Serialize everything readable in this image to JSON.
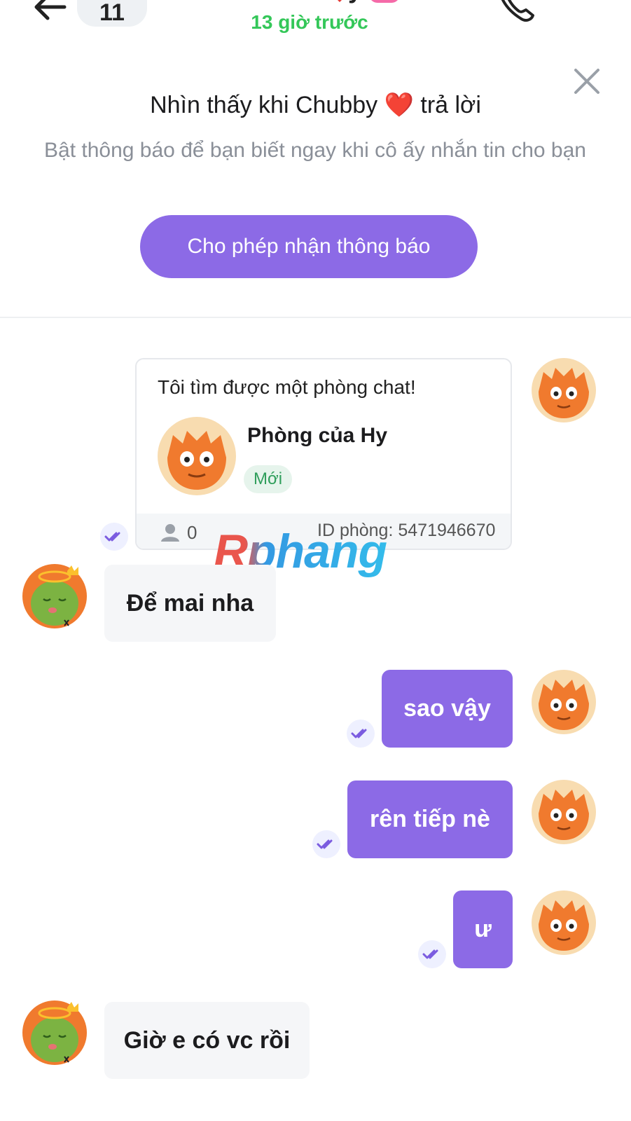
{
  "header": {
    "unread_count": "11",
    "contact_name": "Chubby",
    "status": "13 giờ trước"
  },
  "notice": {
    "title": "Nhìn thấy khi Chubby ❤️ trả lời",
    "subtitle": "Bật thông báo để bạn biết ngay khi cô ấy nhắn tin cho bạn",
    "button": "Cho phép nhận thông báo"
  },
  "room_card": {
    "intro": "Tôi tìm được một phòng chat!",
    "room_name": "Phòng của Hy",
    "badge": "Mới",
    "member_count": "0",
    "room_id": "ID phòng: 5471946670"
  },
  "messages": [
    {
      "text": "Để mai nha",
      "sender": "other"
    },
    {
      "text": "sao vậy",
      "sender": "me"
    },
    {
      "text": "rên tiếp nè",
      "sender": "me"
    },
    {
      "text": "ư",
      "sender": "me"
    },
    {
      "text": "Giờ e có vc rồi",
      "sender": "other"
    }
  ],
  "watermark": "Rphang",
  "colors": {
    "accent": "#8c6ae6",
    "status_green": "#34c759",
    "incoming_bubble": "#f5f6f8"
  }
}
